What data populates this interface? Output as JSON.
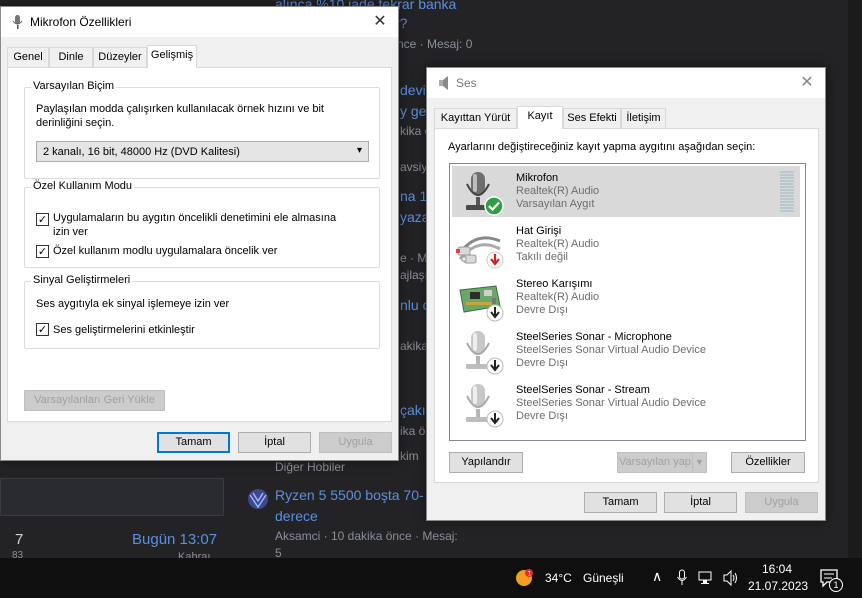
{
  "background": {
    "lines": [
      {
        "text": "alınca %10 iade tekrar banka",
        "kind": "link"
      },
      {
        "text": "r?",
        "kind": "link"
      },
      {
        "text": "nce · Mesaj: 0",
        "kind": "muted"
      },
      {
        "text": "devi",
        "kind": "link"
      },
      {
        "text": "y ge",
        "kind": "link"
      },
      {
        "text": "kika ö",
        "kind": "muted"
      },
      {
        "text": "avsiy",
        "kind": "muted"
      },
      {
        "text": "na 1",
        "kind": "link"
      },
      {
        "text": "yaza",
        "kind": "link"
      },
      {
        "text": "e · M",
        "kind": "muted"
      },
      {
        "text": "ajlaşı",
        "kind": "muted"
      },
      {
        "text": "nlu c",
        "kind": "link"
      },
      {
        "text": "akika ö",
        "kind": "muted"
      },
      {
        "text": "çakı i",
        "kind": "link"
      },
      {
        "text": "ika ö",
        "kind": "muted"
      },
      {
        "text": "kim",
        "kind": "muted"
      },
      {
        "text": "Diğer Hobiler",
        "kind": "muted"
      },
      {
        "text": "Ryzen 5 5500 boşta 70-",
        "kind": "link"
      },
      {
        "text": "derece",
        "kind": "link"
      },
      {
        "text": "Aksamci · 10 dakika önce · Mesaj:",
        "kind": "muted"
      },
      {
        "text": "5",
        "kind": "muted"
      }
    ],
    "left_count": "7",
    "left_sub": "83",
    "left_time": "Bugün 13:07",
    "left_user": "Kahraı"
  },
  "mic_dialog": {
    "title": "Mikrofon Özellikleri",
    "tabs": [
      "Genel",
      "Dinle",
      "Düzeyler",
      "Gelişmiş"
    ],
    "active_tab": 3,
    "default_format": {
      "title": "Varsayılan Biçim",
      "desc_line1": "Paylaşılan modda çalışırken kullanılacak örnek hızını ve bit",
      "desc_line2": "derinliğini seçin.",
      "selected": "2 kanalı, 16 bit, 48000 Hz (DVD Kalitesi)"
    },
    "exclusive_mode": {
      "title": "Özel Kullanım Modu",
      "opt1_line1": "Uygulamaların bu aygıtın öncelikli denetimini ele almasına",
      "opt1_line2": "izin ver",
      "opt1_checked": true,
      "opt2": "Özel kullanım modlu uygulamalara öncelik ver",
      "opt2_checked": true
    },
    "enhancements": {
      "title": "Sinyal Geliştirmeleri",
      "desc": "Ses aygıtıyla ek sinyal işlemeye izin ver",
      "opt": "Ses geliştirmelerini etkinleştir",
      "opt_checked": true
    },
    "restore_label": "Varsayılanları Geri Yükle",
    "ok_label": "Tamam",
    "cancel_label": "İptal",
    "apply_label": "Uygula"
  },
  "sound_dialog": {
    "title": "Ses",
    "tabs": [
      "Kayıttan Yürüt",
      "Kayıt",
      "Ses Efekti",
      "İletişim"
    ],
    "active_tab": 1,
    "instruction": "Ayarlarını değiştireceğiniz kayıt yapma aygıtını aşağıdan seçin:",
    "devices": [
      {
        "name": "Mikrofon",
        "driver": "Realtek(R) Audio",
        "status": "Varsayılan Aygıt",
        "icon": "microphone-icon",
        "badge": "check-badge-icon"
      },
      {
        "name": "Hat Girişi",
        "driver": "Realtek(R) Audio",
        "status": "Takılı değil",
        "icon": "line-in-cable-icon",
        "badge": "red-down-arrow-icon"
      },
      {
        "name": "Stereo Karışımı",
        "driver": "Realtek(R) Audio",
        "status": "Devre Dışı",
        "icon": "circuit-board-icon",
        "badge": "down-arrow-icon"
      },
      {
        "name": "SteelSeries Sonar - Microphone",
        "driver": "SteelSeries Sonar Virtual Audio Device",
        "status": "Devre Dışı",
        "icon": "microphone-icon",
        "badge": "down-arrow-icon"
      },
      {
        "name": "SteelSeries Sonar - Stream",
        "driver": "SteelSeries Sonar Virtual Audio Device",
        "status": "Devre Dışı",
        "icon": "microphone-icon",
        "badge": "down-arrow-icon"
      }
    ],
    "configure_label": "Yapılandır",
    "set_default_label": "Varsayılan yap",
    "properties_label": "Özellikler",
    "ok_label": "Tamam",
    "cancel_label": "İptal",
    "apply_label": "Uygula"
  },
  "taskbar": {
    "weather_temp": "34°C",
    "weather_desc": "Güneşli",
    "time": "16:04",
    "date": "21.07.2023",
    "notif_count": "1"
  }
}
